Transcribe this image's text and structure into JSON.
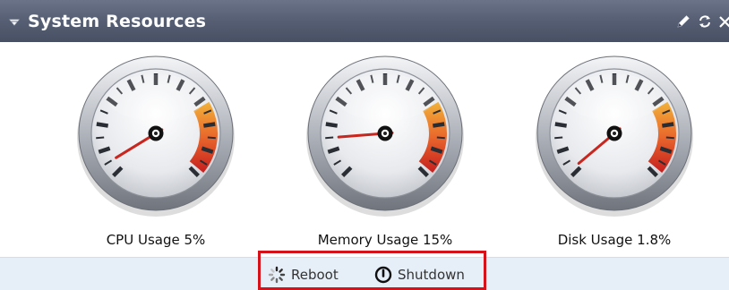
{
  "panel": {
    "title": "System Resources",
    "colors": {
      "title_bar": "#555e72",
      "action_bar": "#e6eef8",
      "needle": "#c8261e",
      "highlight_box": "#d5121a"
    },
    "icons": [
      "collapse-arrow-icon",
      "edit-pencil-icon",
      "refresh-icon",
      "close-icon"
    ]
  },
  "gauges": [
    {
      "label": "CPU Usage 5%",
      "value": 5,
      "unit": "%"
    },
    {
      "label": "Memory Usage 15%",
      "value": 15,
      "unit": "%"
    },
    {
      "label": "Disk Usage 1.8%",
      "value": 1.8,
      "unit": "%"
    }
  ],
  "actions": {
    "reboot_label": "Reboot",
    "shutdown_label": "Shutdown"
  }
}
